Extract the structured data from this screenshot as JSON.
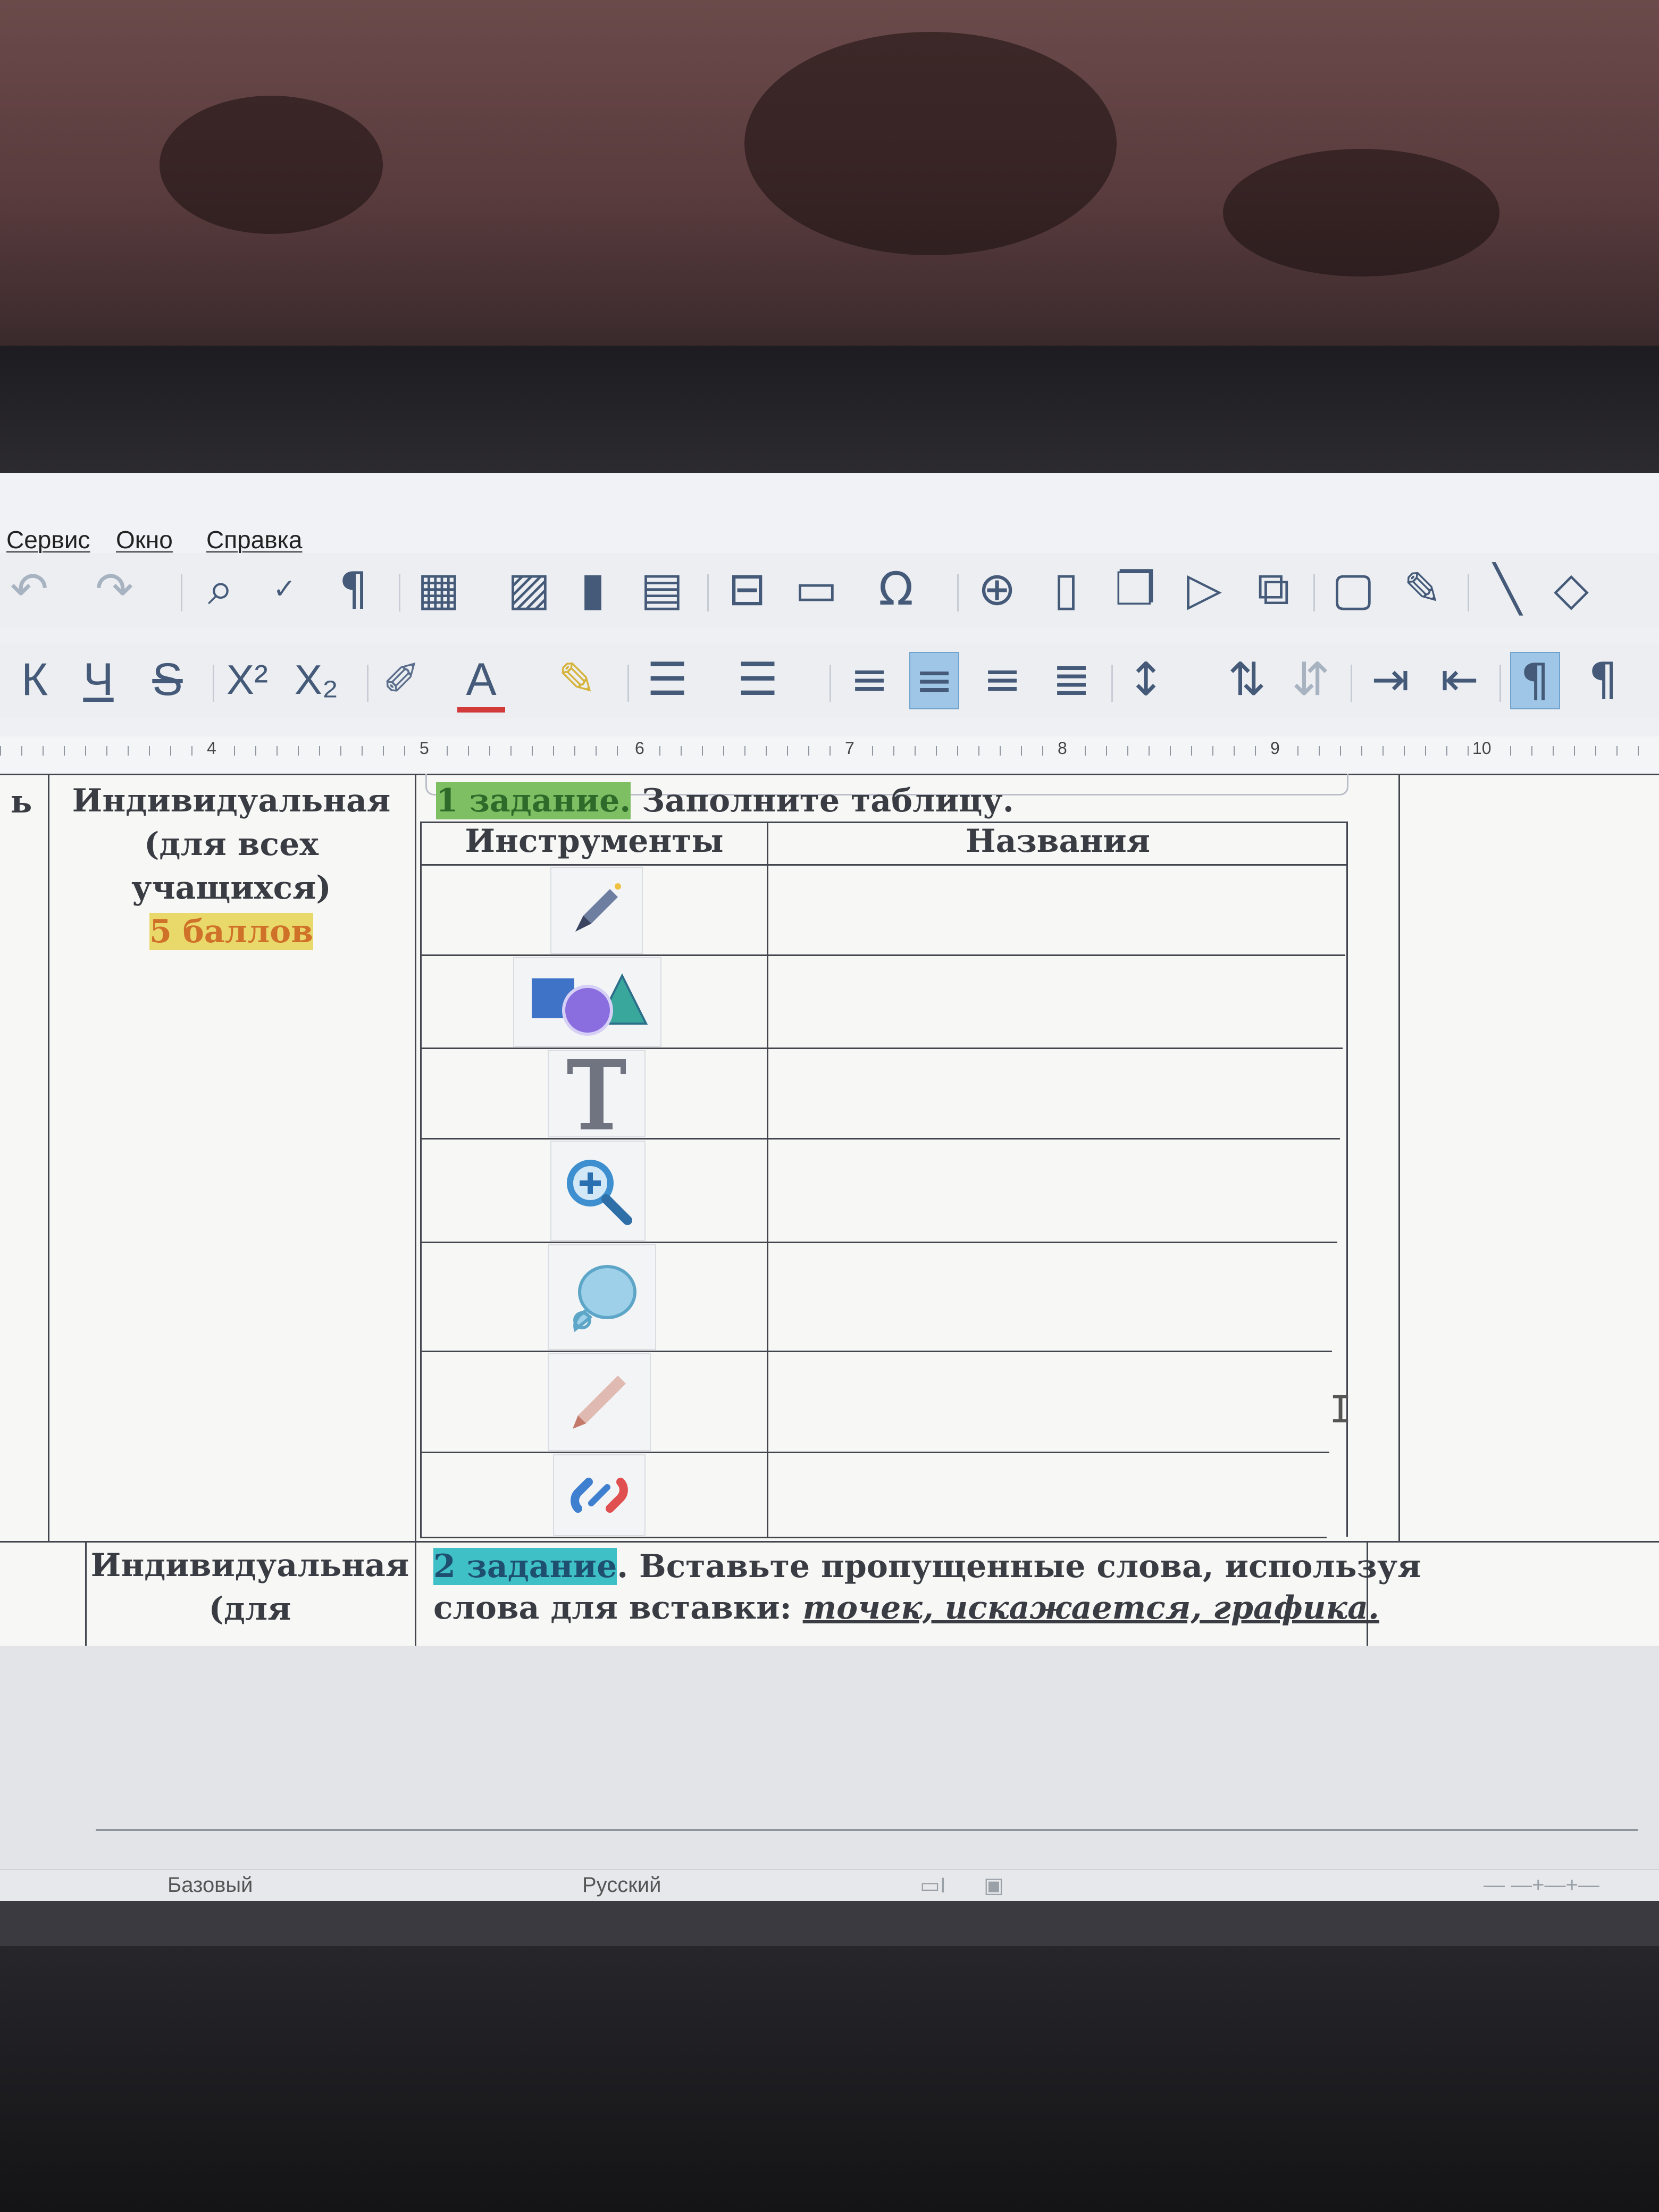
{
  "menu": {
    "service": "Сервис",
    "window": "Окно",
    "help": "Справка"
  },
  "ruler": {
    "ticks": [
      "4",
      "5",
      "6",
      "7",
      "8",
      "9",
      "10"
    ]
  },
  "toolbar2": {
    "bold": "К",
    "underline": "Ч",
    "strike": "S",
    "superscript": "X²",
    "subscript": "X₂",
    "font_color": "A"
  },
  "left_cell": {
    "line1": "Индивидуальная",
    "line2": "(для всех",
    "line3": "учащихся)",
    "score": "5 баллов"
  },
  "task1": {
    "label": "1 задание.",
    "text": "Заполните таблицу."
  },
  "inner_table": {
    "headers": [
      "Инструменты",
      "Названия"
    ],
    "rows": [
      {
        "icon": "pen-icon"
      },
      {
        "icon": "shapes-icon"
      },
      {
        "icon": "text-icon"
      },
      {
        "icon": "zoom-icon"
      },
      {
        "icon": "callout-icon"
      },
      {
        "icon": "pencil-icon"
      },
      {
        "icon": "link-icon"
      }
    ]
  },
  "row2": {
    "line1": "Индивидуальная",
    "line2": "(для"
  },
  "task2": {
    "label": "2 задание",
    "text1": ". Вставьте пропущенные слова, используя",
    "text2": "слова для вставки: ",
    "words": "точек, искажается, графика."
  },
  "left_edge_letter": "ь",
  "statusbar": {
    "style": "Базовый",
    "language": "Русский"
  }
}
